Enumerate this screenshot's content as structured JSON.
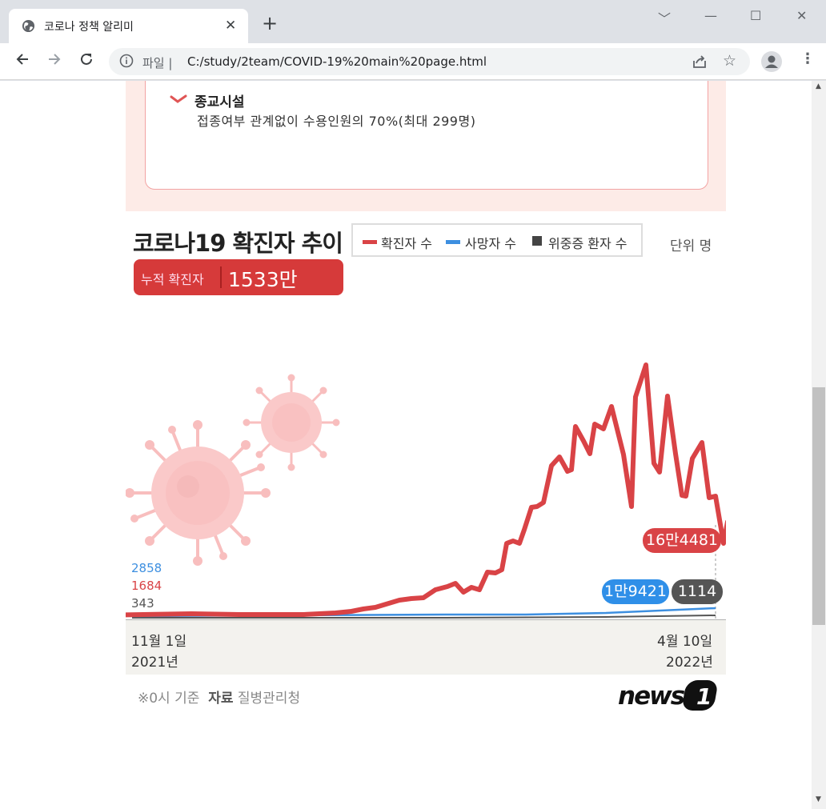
{
  "browser": {
    "tab_title": "코로나 정책 알리미",
    "tab_close": "✕",
    "new_tab": "+",
    "address_scheme": "파일 |",
    "address_url": "C:/study/2team/COVID-19%20main%20page.html",
    "window_controls": [
      "﹀",
      "—",
      "☐",
      "✕"
    ]
  },
  "notice": {
    "title": "종교시설",
    "body": "접종여부 관계없이 수용인원의 70%(최대 299명)"
  },
  "infographic": {
    "title": "코로나19 확진자 추이",
    "unit": "단위 명",
    "cumulative_label": "누적 확진자",
    "cumulative_value": "1533만3670",
    "start_values": {
      "deaths": "2858",
      "confirmed": "1684",
      "critical": "343"
    },
    "end_badges": {
      "confirmed": "16만4481",
      "deaths": "1만9421",
      "critical": "1114"
    },
    "axis": {
      "start_date": "11월 1일",
      "start_year": "2021년",
      "end_date": "4월 10일",
      "end_year": "2022년"
    },
    "footer_prefix": "※0시 기준",
    "footer_source_label": "자료",
    "footer_source": "질병관리청",
    "logo_text": "news1"
  },
  "colors": {
    "confirmed": "#d94346",
    "deaths": "#3d8fe0",
    "critical": "#555555"
  },
  "chart_data": {
    "type": "line",
    "title": "코로나19 확진자 추이",
    "x_range": [
      "2021-11-01",
      "2022-04-10"
    ],
    "series": [
      {
        "name": "확진자 수",
        "start": 1684,
        "end": 164481,
        "peak": 621328
      },
      {
        "name": "사망자 수",
        "start": 2858,
        "end": 19421
      },
      {
        "name": "위중증 환자 수",
        "start": 343,
        "end": 1114
      }
    ],
    "legend": "top",
    "grid": false
  }
}
